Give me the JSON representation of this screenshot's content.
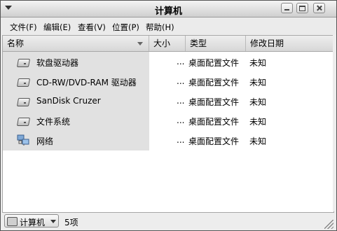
{
  "window": {
    "title": "计算机"
  },
  "menu": [
    "文件(F)",
    "编辑(E)",
    "查看(V)",
    "位置(P)",
    "帮助(H)"
  ],
  "columns": {
    "name": "名称",
    "size": "大小",
    "type": "类型",
    "date": "修改日期"
  },
  "rows": [
    {
      "icon": "floppy-drive-icon",
      "name": "软盘驱动器",
      "size": "...",
      "type": "桌面配置文件",
      "date": "未知"
    },
    {
      "icon": "optical-drive-icon",
      "name": "CD-RW/DVD-RAM 驱动器",
      "size": "...",
      "type": "桌面配置文件",
      "date": "未知"
    },
    {
      "icon": "usb-drive-icon",
      "name": "SanDisk Cruzer",
      "size": "...",
      "type": "桌面配置文件",
      "date": "未知"
    },
    {
      "icon": "filesystem-drive-icon",
      "name": "文件系统",
      "size": "...",
      "type": "桌面配置文件",
      "date": "未知"
    },
    {
      "icon": "network-icon",
      "name": "网络",
      "size": "...",
      "type": "桌面配置文件",
      "date": "未知"
    }
  ],
  "statusbar": {
    "location": "计算机",
    "count": "5项"
  },
  "colors": {
    "accent": "#ededed",
    "name_column_bg": "#e1e1e1"
  }
}
